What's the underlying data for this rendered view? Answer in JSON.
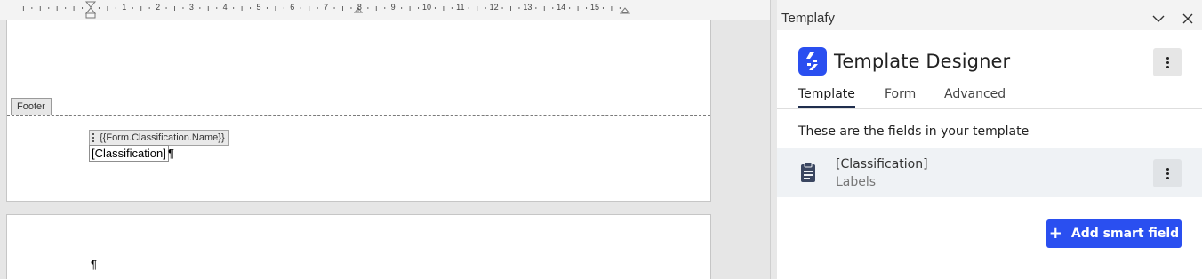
{
  "document": {
    "ruler_numbers": [
      "1",
      "2",
      "3",
      "4",
      "5",
      "6",
      "7",
      "8",
      "9",
      "10",
      "11",
      "12",
      "13",
      "14",
      "15"
    ],
    "footer_label": "Footer",
    "content_control_tag": "{{Form.Classification.Name}}",
    "content_control_text": "[Classification]",
    "pilcrow": "¶"
  },
  "pane": {
    "title": "Templafy",
    "collapse_icon": "chevron-down-icon",
    "close_icon": "close-icon",
    "app_title": "Template Designer",
    "logo_icon": "templafy-logo-icon",
    "accent_color": "#2a4ff0",
    "tabs": [
      {
        "label": "Template",
        "active": true
      },
      {
        "label": "Form",
        "active": false
      },
      {
        "label": "Advanced",
        "active": false
      }
    ],
    "section_heading": "These are the fields in your template",
    "fields": [
      {
        "name": "[Classification]",
        "type": "Labels",
        "icon": "clipboard-icon"
      }
    ],
    "add_button_label": "Add smart field",
    "add_button_icon": "plus-icon"
  }
}
